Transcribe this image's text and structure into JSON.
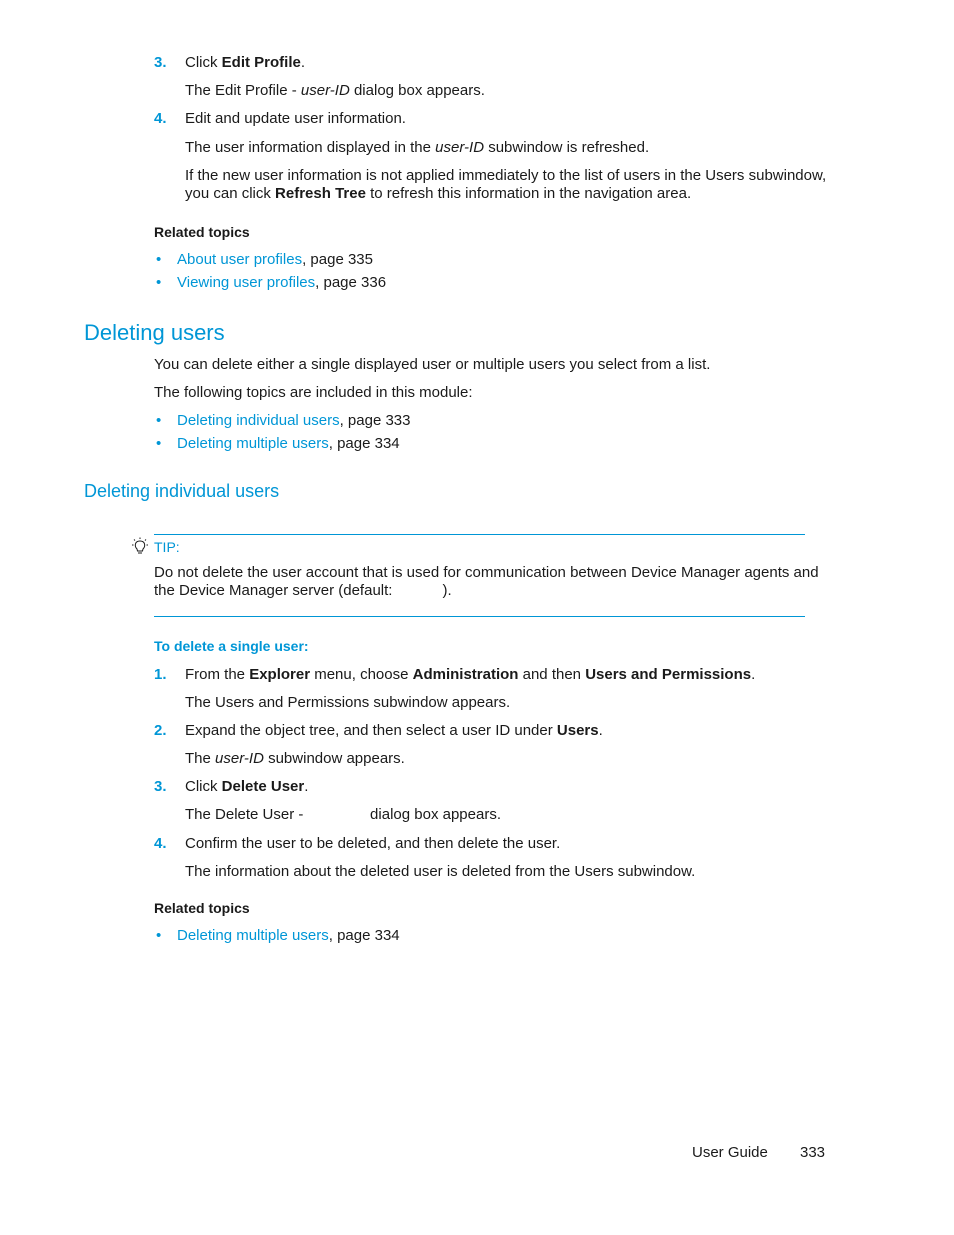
{
  "prev_section": {
    "steps": [
      {
        "num": "3.",
        "parts": [
          "Click ",
          "Edit Profile",
          "."
        ],
        "result": [
          "The Edit Profile - ",
          "user-ID",
          " dialog box appears."
        ]
      },
      {
        "num": "4.",
        "text": "Edit and update user information.",
        "result": [
          "The user information displayed in the ",
          "user-ID",
          " subwindow is refreshed."
        ],
        "note_line1": "If the new user information is not applied immediately to the list of users in the Users subwindow,",
        "note_line2": [
          "you can click ",
          "Refresh Tree",
          " to refresh this information in the navigation area."
        ]
      }
    ],
    "related_title": "Related topics",
    "related": [
      {
        "link": "About user profiles",
        "suffix": ", page 335"
      },
      {
        "link": "Viewing user profiles",
        "suffix": ", page 336"
      }
    ]
  },
  "deleting_users": {
    "heading": "Deleting users",
    "intro": "You can delete either a single displayed user or multiple users you select from a list.",
    "topics_intro": "The following topics are included in this module:",
    "topics": [
      {
        "link": "Deleting individual users",
        "suffix": ", page 333"
      },
      {
        "link": "Deleting multiple users",
        "suffix": ", page 334"
      }
    ]
  },
  "deleting_individual": {
    "heading": "Deleting individual users",
    "tip_label": "TIP:",
    "tip_line1": "Do not delete the user account that is used for communication between Device Manager agents and",
    "tip_line2": "the Device Manager server (default:            ).",
    "procedure_title": "To delete a single user:",
    "steps": [
      {
        "num": "1.",
        "parts": [
          "From the ",
          "Explorer",
          " menu, choose ",
          "Administration",
          " and then ",
          "Users and Permissions",
          "."
        ],
        "result": "The Users and Permissions subwindow appears."
      },
      {
        "num": "2.",
        "parts": [
          "Expand the object tree, and then select a user ID under ",
          "Users",
          "."
        ],
        "result": [
          "The ",
          "user-ID",
          " subwindow appears."
        ]
      },
      {
        "num": "3.",
        "parts": [
          "Click ",
          "Delete User",
          "."
        ],
        "result": "The Delete User -                dialog box appears."
      },
      {
        "num": "4.",
        "text": "Confirm the user to be deleted, and then delete the user.",
        "result": "The information about the deleted user is deleted from the Users subwindow."
      }
    ],
    "related_title": "Related topics",
    "related": [
      {
        "link": "Deleting multiple users",
        "suffix": ", page 334"
      }
    ]
  },
  "footer": {
    "title": "User Guide",
    "page": "333"
  },
  "colors": {
    "accent": "#0096d6",
    "text": "#1a1a1a"
  }
}
